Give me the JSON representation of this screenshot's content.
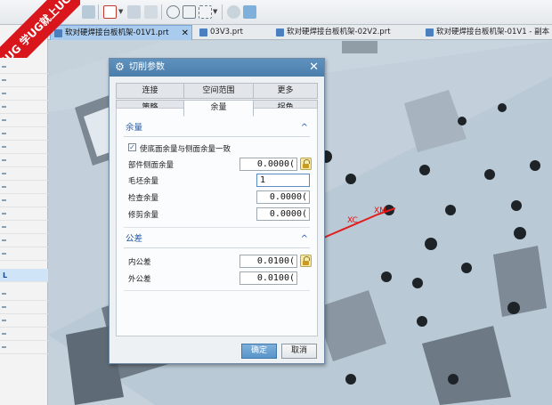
{
  "watermark": {
    "line1": "9SUG",
    "line2": "学UG就上UG网"
  },
  "toolbar": {
    "icons": [
      "undo-icon",
      "redo-icon",
      "snap-icon",
      "filter-icon",
      "pan-icon",
      "view-icon",
      "zoom-icon",
      "layer-icon",
      "render-icon",
      "cube-icon"
    ]
  },
  "tabs": [
    {
      "label": "软对硬焊接台板机架-01V1.prt",
      "active": true
    },
    {
      "label": "03V3.prt",
      "active": false
    },
    {
      "label": "软对硬焊接台板机架-02V2.prt",
      "active": false
    },
    {
      "label": "软对硬焊接台板机架-01V1 - 副本",
      "active": false
    }
  ],
  "left_panel": {
    "selected_label": "L"
  },
  "viewport": {
    "axis_xc": "XC",
    "axis_xm": "XM"
  },
  "dialog": {
    "title": "切削参数",
    "tabs_row1": [
      "连接",
      "空间范围",
      "更多"
    ],
    "tabs_row2": [
      "策略",
      "余量",
      "拐角"
    ],
    "active_tab": "余量",
    "section_allowance": {
      "title": "余量",
      "checkbox_label": "使底面余量与侧面余量一致",
      "checkbox_checked": true,
      "rows": [
        {
          "label": "部件侧面余量",
          "value": "0.0000("
        },
        {
          "label": "毛坯余量",
          "value": "1"
        },
        {
          "label": "检查余量",
          "value": "0.0000("
        },
        {
          "label": "修剪余量",
          "value": "0.0000("
        }
      ]
    },
    "section_tolerance": {
      "title": "公差",
      "rows": [
        {
          "label": "内公差",
          "value": "0.0100("
        },
        {
          "label": "外公差",
          "value": "0.0100("
        }
      ]
    },
    "ok_label": "确定",
    "cancel_label": "取消"
  }
}
